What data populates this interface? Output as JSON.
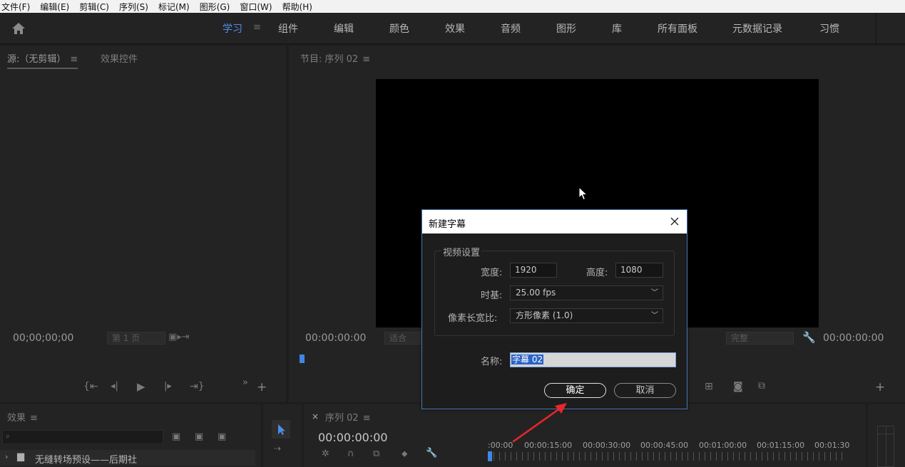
{
  "menubar": {
    "items": [
      "文件(F)",
      "编辑(E)",
      "剪辑(C)",
      "序列(S)",
      "标记(M)",
      "图形(G)",
      "窗口(W)",
      "帮助(H)"
    ]
  },
  "workspaces": {
    "tabs": [
      "学习",
      "组件",
      "编辑",
      "颜色",
      "效果",
      "音频",
      "图形",
      "库",
      "所有面板",
      "元数据记录",
      "习惯"
    ],
    "active": "学习",
    "accent": "#4a8ee8"
  },
  "source_panel": {
    "tab_source": "源:（无剪辑）",
    "tab_effect_controls": "效果控件",
    "timecode": "00;00;00;00",
    "page": "第 1 页"
  },
  "program_panel": {
    "tab": "节目: 序列 02",
    "timecode_left": "00:00:00:00",
    "fit": "适合",
    "quality": "完整",
    "timecode_right": "00:00:00:00"
  },
  "effects_panel": {
    "tab": "效果",
    "bin_label": "无缝转场预设——后期社"
  },
  "timeline_panel": {
    "tab": "序列 02",
    "close_glyph": "×",
    "timecode": "00:00:00:00",
    "ruler": [
      ":00:00",
      "00:00:15:00",
      "00:00:30:00",
      "00:00:45:00",
      "00:01:00:00",
      "00:01:15:00",
      "00:01:30"
    ]
  },
  "dialog": {
    "title": "新建字幕",
    "group_title": "视频设置",
    "width_label": "宽度:",
    "width_value": "1920",
    "height_label": "高度:",
    "height_value": "1080",
    "timebase_label": "时基:",
    "timebase_value": "25.00 fps",
    "pixel_aspect_label": "像素长宽比:",
    "pixel_aspect_value": "方形像素 (1.0)",
    "name_label": "名称:",
    "name_value": "字幕 02",
    "ok_label": "确定",
    "cancel_label": "取消",
    "border_color": "#4a76b8"
  },
  "annotation": {
    "arrow_color": "#e8262b"
  }
}
